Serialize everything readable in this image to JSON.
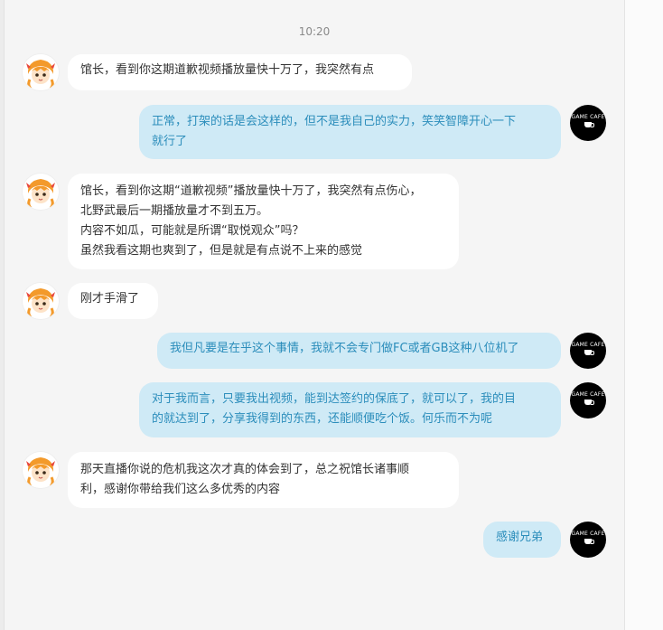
{
  "chat": {
    "timestamp": "10:20",
    "messages": [
      {
        "side": "left",
        "avatar": "anime-girl-avatar",
        "lines": [
          "馆长，看到你这期道歉视频播放量快十万了，我突然有点"
        ]
      },
      {
        "side": "right",
        "avatar": "game-cafe-logo",
        "lines": [
          "正常，打架的话是会这样的，但不是我自己的实力，笑笑智障开心一下",
          "就行了"
        ]
      },
      {
        "side": "left",
        "avatar": "anime-girl-avatar",
        "lines": [
          "馆长，看到你这期“道歉视频”播放量快十万了，我突然有点伤心，",
          "北野武最后一期播放量才不到五万。",
          "内容不如瓜，可能就是所谓“取悦观众”吗？",
          "虽然我看这期也爽到了，但是就是有点说不上来的感觉"
        ]
      },
      {
        "side": "left",
        "avatar": "anime-girl-avatar",
        "lines": [
          "刚才手滑了"
        ]
      },
      {
        "side": "right",
        "avatar": "game-cafe-logo",
        "lines": [
          "我但凡要是在乎这个事情，我就不会专门做FC或者GB这种八位机了"
        ]
      },
      {
        "side": "right",
        "avatar": "game-cafe-logo",
        "lines": [
          "对于我而言，只要我出视频，能到达签约的保底了，就可以了，我的目",
          "的就达到了，分享我得到的东西，还能顺便吃个饭。何乐而不为呢"
        ]
      },
      {
        "side": "left",
        "avatar": "anime-girl-avatar",
        "lines": [
          "那天直播你说的危机我这次才真的体会到了，总之祝馆长诸事顺",
          "利，感谢你带给我们这么多优秀的内容"
        ]
      },
      {
        "side": "right",
        "avatar": "game-cafe-logo",
        "lines": [
          "感谢兄弟"
        ]
      }
    ]
  },
  "logo_text": "GAME CAFE",
  "colors": {
    "page_bg": "#f5f5f5",
    "left_bubble": "#ffffff",
    "right_bubble": "#cfeaf6",
    "right_text": "#2b8dbb",
    "left_text": "#333333"
  }
}
